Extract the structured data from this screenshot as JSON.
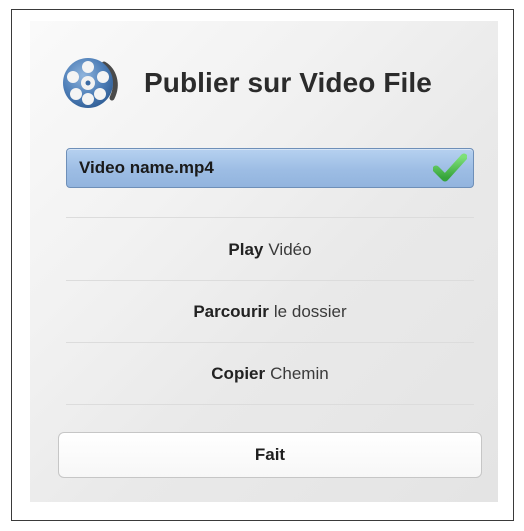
{
  "dialog": {
    "title": "Publier sur Video File",
    "app_icon": "film-reel-icon"
  },
  "file": {
    "name": "Video name.mp4",
    "status_icon": "checkmark-icon",
    "status_color": "#4fbf4a"
  },
  "actions": [
    {
      "bold": "Play",
      "rest": "Vidéo"
    },
    {
      "bold": "Parcourir",
      "rest": "le dossier"
    },
    {
      "bold": "Copier",
      "rest": "Chemin"
    }
  ],
  "done_label": "Fait"
}
